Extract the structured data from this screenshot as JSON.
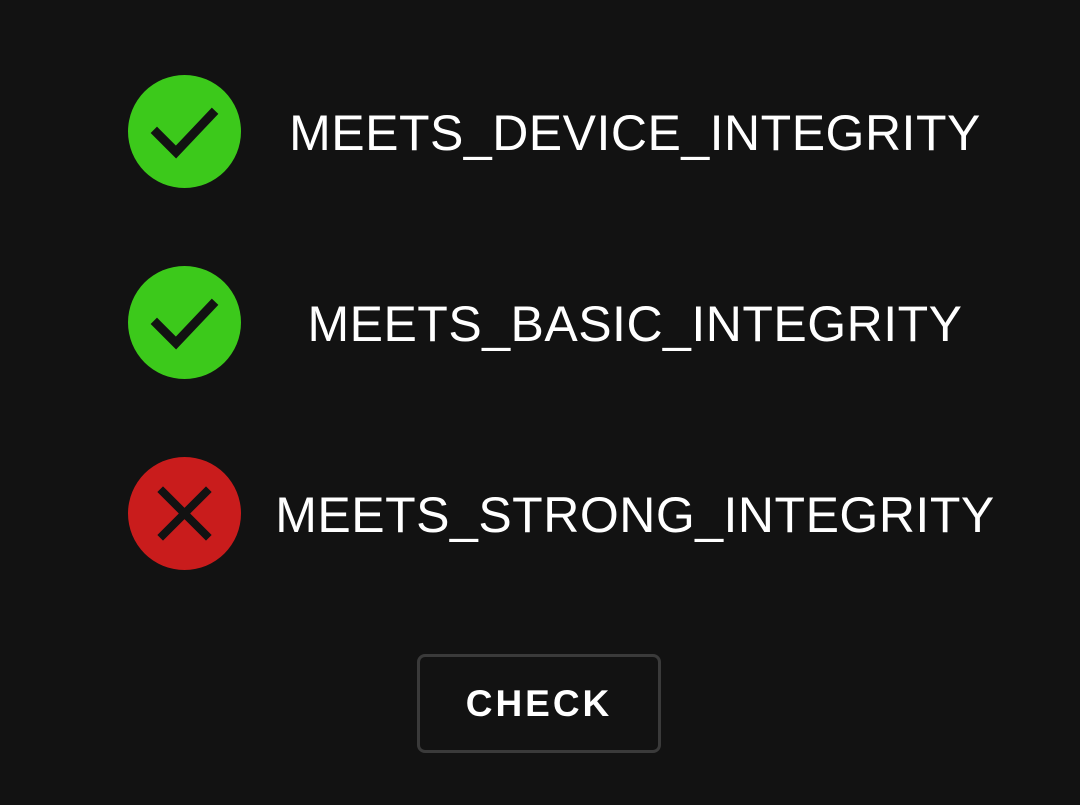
{
  "colors": {
    "background": "#121212",
    "pass": "#3cc91b",
    "fail": "#c91c1c",
    "icon_glyph": "#121212",
    "text": "#ffffff",
    "button_border": "#3a3a3a"
  },
  "checks": [
    {
      "label": "MEETS_DEVICE_INTEGRITY",
      "status": "pass",
      "icon": "check-icon"
    },
    {
      "label": "MEETS_BASIC_INTEGRITY",
      "status": "pass",
      "icon": "check-icon"
    },
    {
      "label": "MEETS_STRONG_INTEGRITY",
      "status": "fail",
      "icon": "close-icon"
    }
  ],
  "button": {
    "label": "CHECK"
  }
}
